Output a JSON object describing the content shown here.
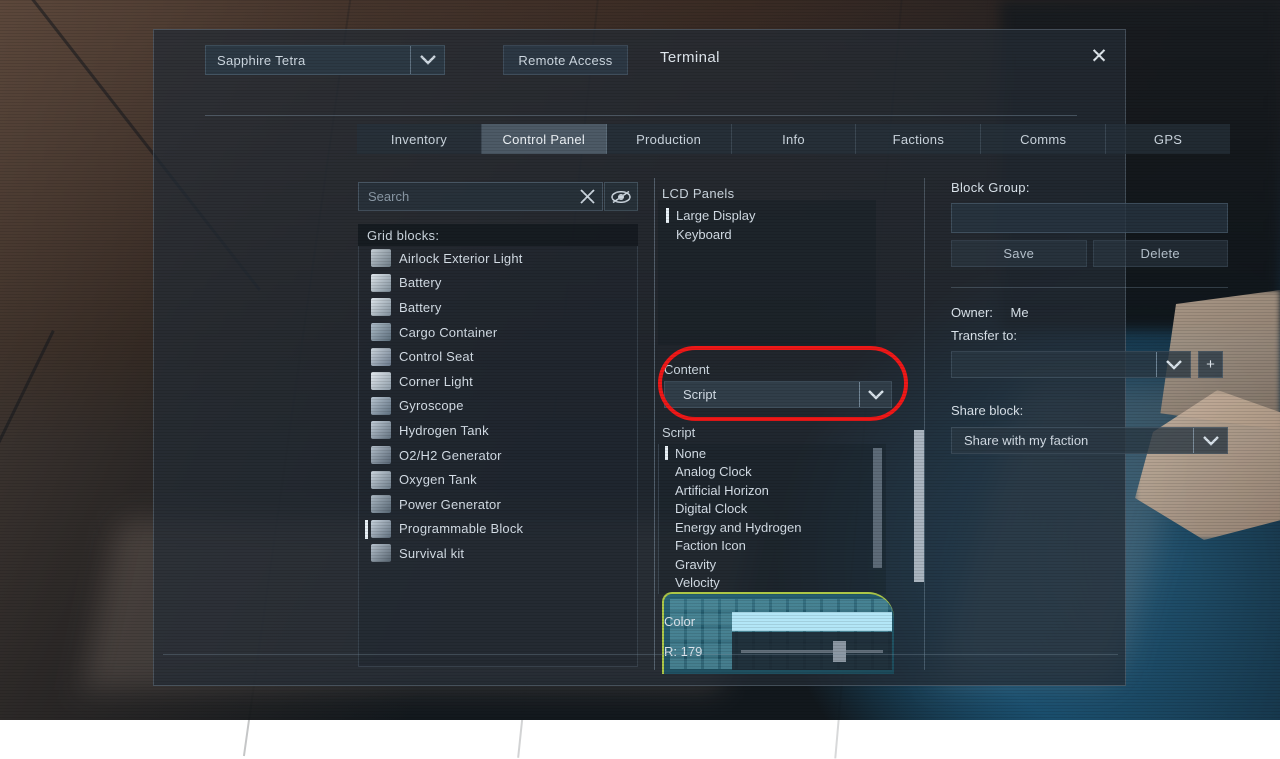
{
  "window": {
    "title": "Terminal",
    "close_label": "✕"
  },
  "header": {
    "grid_name": "Sapphire Tetra",
    "remote_access_label": "Remote Access",
    "title": "Terminal"
  },
  "tabs": [
    {
      "label": "Inventory",
      "active": false
    },
    {
      "label": "Control Panel",
      "active": true
    },
    {
      "label": "Production",
      "active": false
    },
    {
      "label": "Info",
      "active": false
    },
    {
      "label": "Factions",
      "active": false
    },
    {
      "label": "Comms",
      "active": false
    },
    {
      "label": "GPS",
      "active": false
    }
  ],
  "left_panel": {
    "search": {
      "placeholder": "Search",
      "value": "",
      "clear_label": "✕"
    },
    "grid_blocks_header": "Grid blocks:",
    "blocks": [
      {
        "label": "Airlock Exterior Light",
        "selected": false,
        "icon": "light-icon"
      },
      {
        "label": "Battery",
        "selected": false,
        "icon": "battery-icon"
      },
      {
        "label": "Battery",
        "selected": false,
        "icon": "battery-icon"
      },
      {
        "label": "Cargo Container",
        "selected": false,
        "icon": "cargo-icon"
      },
      {
        "label": "Control Seat",
        "selected": false,
        "icon": "seat-icon"
      },
      {
        "label": "Corner Light",
        "selected": false,
        "icon": "corner-light-icon"
      },
      {
        "label": "Gyroscope",
        "selected": false,
        "icon": "gyroscope-icon"
      },
      {
        "label": "Hydrogen Tank",
        "selected": false,
        "icon": "tank-icon"
      },
      {
        "label": "O2/H2 Generator",
        "selected": false,
        "icon": "generator-icon"
      },
      {
        "label": "Oxygen Tank",
        "selected": false,
        "icon": "oxygen-tank-icon"
      },
      {
        "label": "Power Generator",
        "selected": false,
        "icon": "power-icon"
      },
      {
        "label": "Programmable Block",
        "selected": true,
        "icon": "programmable-block-icon"
      },
      {
        "label": "Survival kit",
        "selected": false,
        "icon": "survival-kit-icon"
      }
    ]
  },
  "center_panel": {
    "lcd_panels_title": "LCD Panels",
    "lcd_items": [
      {
        "label": "Large Display",
        "selected": true
      },
      {
        "label": "Keyboard",
        "selected": false
      }
    ],
    "content": {
      "label": "Content",
      "value": "Script",
      "highlighted": true,
      "highlight_color": "#f01818"
    },
    "script": {
      "label": "Script",
      "items": [
        {
          "label": "None",
          "selected": true
        },
        {
          "label": "Analog Clock",
          "selected": false
        },
        {
          "label": "Artificial Horizon",
          "selected": false
        },
        {
          "label": "Digital Clock",
          "selected": false
        },
        {
          "label": "Energy and Hydrogen",
          "selected": false
        },
        {
          "label": "Faction Icon",
          "selected": false
        },
        {
          "label": "Gravity",
          "selected": false
        },
        {
          "label": "Velocity",
          "selected": false
        }
      ]
    },
    "color": {
      "label": "Color",
      "swatch_hex": "#b3e6f7",
      "channel_label": "R: 179",
      "channel_value": 179,
      "channel_max": 255
    }
  },
  "right_panel": {
    "block_group_label": "Block Group:",
    "block_group_value": "",
    "save_label": "Save",
    "delete_label": "Delete",
    "owner_label": "Owner:",
    "owner_value": "Me",
    "transfer_label": "Transfer to:",
    "transfer_value": "",
    "add_label": "+",
    "share_label": "Share block:",
    "share_value": "Share with my faction"
  }
}
